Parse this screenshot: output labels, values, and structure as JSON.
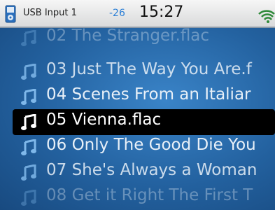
{
  "status_bar": {
    "source": "USB Input 1",
    "volume": "-26",
    "time": "15:27",
    "icons": [
      "media-player-icon",
      "wifi-icon"
    ]
  },
  "tracks": [
    {
      "label": "02 The Stranger.flac",
      "selected": false
    },
    {
      "label": "03 Just The Way You Are.f",
      "selected": false
    },
    {
      "label": "04 Scenes From an Italiar",
      "selected": false
    },
    {
      "label": "05 Vienna.flac",
      "selected": true
    },
    {
      "label": "06 Only The Good Die You",
      "selected": false
    },
    {
      "label": "07 She's Always a Woman",
      "selected": false
    },
    {
      "label": "08 Get it Right The First T",
      "selected": false
    }
  ],
  "colors": {
    "list_background": "#23619f",
    "selection": "#000000",
    "volume_text": "#2b7fd6",
    "note_icon": "#7fb8ea"
  }
}
